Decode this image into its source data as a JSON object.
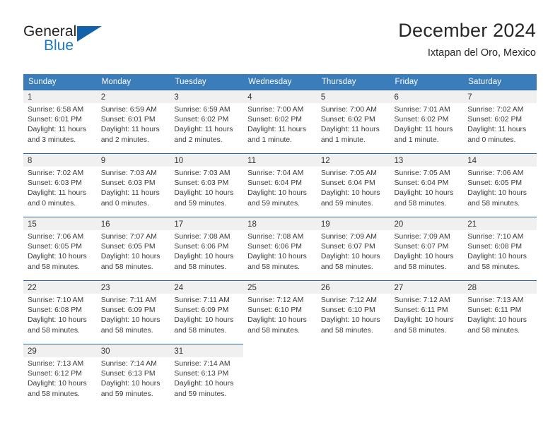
{
  "brand": {
    "name_part1": "General",
    "name_part2": "Blue",
    "logo_icon": "triangle-logo-icon",
    "accent_color": "#1262ab"
  },
  "header": {
    "title": "December 2024",
    "subtitle": "Ixtapan del Oro, Mexico"
  },
  "calendar": {
    "header_bg_color": "#3b7cba",
    "row_rule_color": "#2b6ca8",
    "daynum_bg_color": "#f0f0f0",
    "weekday_headers": [
      "Sunday",
      "Monday",
      "Tuesday",
      "Wednesday",
      "Thursday",
      "Friday",
      "Saturday"
    ],
    "weeks": [
      [
        {
          "day": "1",
          "sunrise": "Sunrise: 6:58 AM",
          "sunset": "Sunset: 6:01 PM",
          "daylight_line1": "Daylight: 11 hours",
          "daylight_line2": "and 3 minutes."
        },
        {
          "day": "2",
          "sunrise": "Sunrise: 6:59 AM",
          "sunset": "Sunset: 6:01 PM",
          "daylight_line1": "Daylight: 11 hours",
          "daylight_line2": "and 2 minutes."
        },
        {
          "day": "3",
          "sunrise": "Sunrise: 6:59 AM",
          "sunset": "Sunset: 6:02 PM",
          "daylight_line1": "Daylight: 11 hours",
          "daylight_line2": "and 2 minutes."
        },
        {
          "day": "4",
          "sunrise": "Sunrise: 7:00 AM",
          "sunset": "Sunset: 6:02 PM",
          "daylight_line1": "Daylight: 11 hours",
          "daylight_line2": "and 1 minute."
        },
        {
          "day": "5",
          "sunrise": "Sunrise: 7:00 AM",
          "sunset": "Sunset: 6:02 PM",
          "daylight_line1": "Daylight: 11 hours",
          "daylight_line2": "and 1 minute."
        },
        {
          "day": "6",
          "sunrise": "Sunrise: 7:01 AM",
          "sunset": "Sunset: 6:02 PM",
          "daylight_line1": "Daylight: 11 hours",
          "daylight_line2": "and 1 minute."
        },
        {
          "day": "7",
          "sunrise": "Sunrise: 7:02 AM",
          "sunset": "Sunset: 6:02 PM",
          "daylight_line1": "Daylight: 11 hours",
          "daylight_line2": "and 0 minutes."
        }
      ],
      [
        {
          "day": "8",
          "sunrise": "Sunrise: 7:02 AM",
          "sunset": "Sunset: 6:03 PM",
          "daylight_line1": "Daylight: 11 hours",
          "daylight_line2": "and 0 minutes."
        },
        {
          "day": "9",
          "sunrise": "Sunrise: 7:03 AM",
          "sunset": "Sunset: 6:03 PM",
          "daylight_line1": "Daylight: 11 hours",
          "daylight_line2": "and 0 minutes."
        },
        {
          "day": "10",
          "sunrise": "Sunrise: 7:03 AM",
          "sunset": "Sunset: 6:03 PM",
          "daylight_line1": "Daylight: 10 hours",
          "daylight_line2": "and 59 minutes."
        },
        {
          "day": "11",
          "sunrise": "Sunrise: 7:04 AM",
          "sunset": "Sunset: 6:04 PM",
          "daylight_line1": "Daylight: 10 hours",
          "daylight_line2": "and 59 minutes."
        },
        {
          "day": "12",
          "sunrise": "Sunrise: 7:05 AM",
          "sunset": "Sunset: 6:04 PM",
          "daylight_line1": "Daylight: 10 hours",
          "daylight_line2": "and 59 minutes."
        },
        {
          "day": "13",
          "sunrise": "Sunrise: 7:05 AM",
          "sunset": "Sunset: 6:04 PM",
          "daylight_line1": "Daylight: 10 hours",
          "daylight_line2": "and 58 minutes."
        },
        {
          "day": "14",
          "sunrise": "Sunrise: 7:06 AM",
          "sunset": "Sunset: 6:05 PM",
          "daylight_line1": "Daylight: 10 hours",
          "daylight_line2": "and 58 minutes."
        }
      ],
      [
        {
          "day": "15",
          "sunrise": "Sunrise: 7:06 AM",
          "sunset": "Sunset: 6:05 PM",
          "daylight_line1": "Daylight: 10 hours",
          "daylight_line2": "and 58 minutes."
        },
        {
          "day": "16",
          "sunrise": "Sunrise: 7:07 AM",
          "sunset": "Sunset: 6:05 PM",
          "daylight_line1": "Daylight: 10 hours",
          "daylight_line2": "and 58 minutes."
        },
        {
          "day": "17",
          "sunrise": "Sunrise: 7:08 AM",
          "sunset": "Sunset: 6:06 PM",
          "daylight_line1": "Daylight: 10 hours",
          "daylight_line2": "and 58 minutes."
        },
        {
          "day": "18",
          "sunrise": "Sunrise: 7:08 AM",
          "sunset": "Sunset: 6:06 PM",
          "daylight_line1": "Daylight: 10 hours",
          "daylight_line2": "and 58 minutes."
        },
        {
          "day": "19",
          "sunrise": "Sunrise: 7:09 AM",
          "sunset": "Sunset: 6:07 PM",
          "daylight_line1": "Daylight: 10 hours",
          "daylight_line2": "and 58 minutes."
        },
        {
          "day": "20",
          "sunrise": "Sunrise: 7:09 AM",
          "sunset": "Sunset: 6:07 PM",
          "daylight_line1": "Daylight: 10 hours",
          "daylight_line2": "and 58 minutes."
        },
        {
          "day": "21",
          "sunrise": "Sunrise: 7:10 AM",
          "sunset": "Sunset: 6:08 PM",
          "daylight_line1": "Daylight: 10 hours",
          "daylight_line2": "and 58 minutes."
        }
      ],
      [
        {
          "day": "22",
          "sunrise": "Sunrise: 7:10 AM",
          "sunset": "Sunset: 6:08 PM",
          "daylight_line1": "Daylight: 10 hours",
          "daylight_line2": "and 58 minutes."
        },
        {
          "day": "23",
          "sunrise": "Sunrise: 7:11 AM",
          "sunset": "Sunset: 6:09 PM",
          "daylight_line1": "Daylight: 10 hours",
          "daylight_line2": "and 58 minutes."
        },
        {
          "day": "24",
          "sunrise": "Sunrise: 7:11 AM",
          "sunset": "Sunset: 6:09 PM",
          "daylight_line1": "Daylight: 10 hours",
          "daylight_line2": "and 58 minutes."
        },
        {
          "day": "25",
          "sunrise": "Sunrise: 7:12 AM",
          "sunset": "Sunset: 6:10 PM",
          "daylight_line1": "Daylight: 10 hours",
          "daylight_line2": "and 58 minutes."
        },
        {
          "day": "26",
          "sunrise": "Sunrise: 7:12 AM",
          "sunset": "Sunset: 6:10 PM",
          "daylight_line1": "Daylight: 10 hours",
          "daylight_line2": "and 58 minutes."
        },
        {
          "day": "27",
          "sunrise": "Sunrise: 7:12 AM",
          "sunset": "Sunset: 6:11 PM",
          "daylight_line1": "Daylight: 10 hours",
          "daylight_line2": "and 58 minutes."
        },
        {
          "day": "28",
          "sunrise": "Sunrise: 7:13 AM",
          "sunset": "Sunset: 6:11 PM",
          "daylight_line1": "Daylight: 10 hours",
          "daylight_line2": "and 58 minutes."
        }
      ],
      [
        {
          "day": "29",
          "sunrise": "Sunrise: 7:13 AM",
          "sunset": "Sunset: 6:12 PM",
          "daylight_line1": "Daylight: 10 hours",
          "daylight_line2": "and 58 minutes."
        },
        {
          "day": "30",
          "sunrise": "Sunrise: 7:14 AM",
          "sunset": "Sunset: 6:13 PM",
          "daylight_line1": "Daylight: 10 hours",
          "daylight_line2": "and 59 minutes."
        },
        {
          "day": "31",
          "sunrise": "Sunrise: 7:14 AM",
          "sunset": "Sunset: 6:13 PM",
          "daylight_line1": "Daylight: 10 hours",
          "daylight_line2": "and 59 minutes."
        },
        {
          "day": "",
          "sunrise": "",
          "sunset": "",
          "daylight_line1": "",
          "daylight_line2": ""
        },
        {
          "day": "",
          "sunrise": "",
          "sunset": "",
          "daylight_line1": "",
          "daylight_line2": ""
        },
        {
          "day": "",
          "sunrise": "",
          "sunset": "",
          "daylight_line1": "",
          "daylight_line2": ""
        },
        {
          "day": "",
          "sunrise": "",
          "sunset": "",
          "daylight_line1": "",
          "daylight_line2": ""
        }
      ]
    ]
  }
}
